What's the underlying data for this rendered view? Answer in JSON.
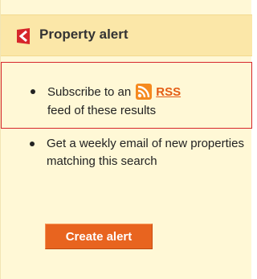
{
  "header": {
    "title": "Property alert",
    "icon": "brand-logo-icon"
  },
  "rss_item": {
    "prefix": "Subscribe to an",
    "icon": "rss-icon",
    "link_label": "RSS",
    "suffix": "feed of these results"
  },
  "email_item": {
    "text": "Get a weekly email of new properties matching this search"
  },
  "button": {
    "label": "Create alert"
  },
  "colors": {
    "accent": "#e8641f",
    "header_bg": "#fbe7a8",
    "panel_bg": "#fff8d6",
    "highlight_border": "#d6262b"
  }
}
